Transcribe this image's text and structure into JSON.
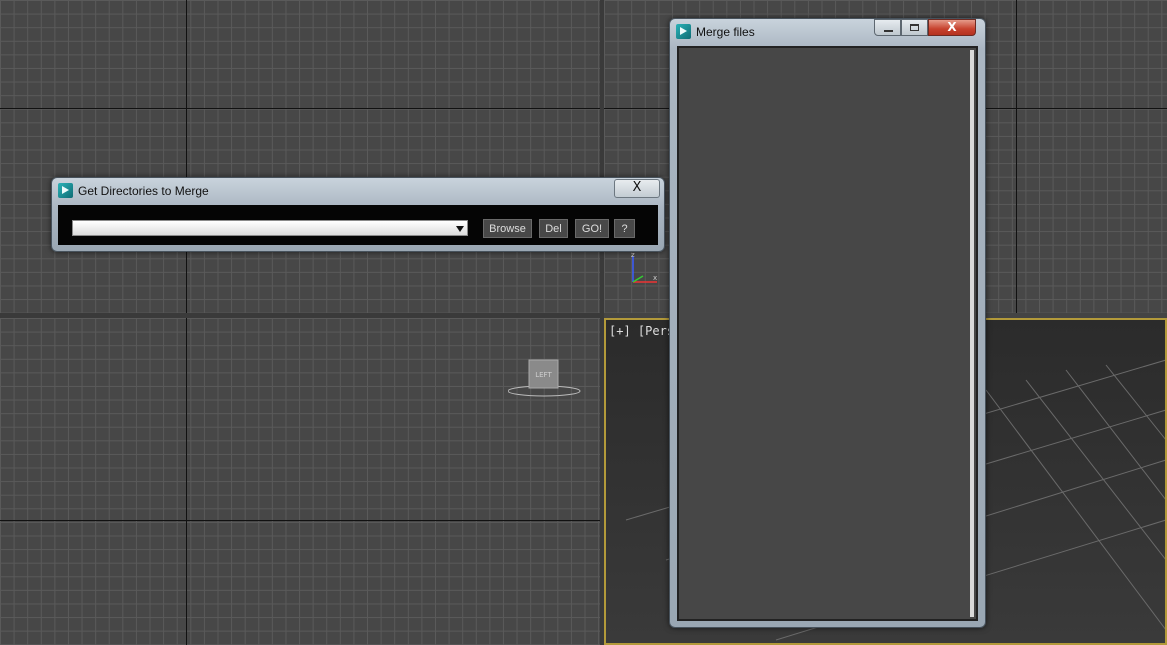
{
  "dir_window": {
    "title": "Get Directories to Merge",
    "close_label": "X",
    "combo_value": "",
    "buttons": {
      "browse": "Browse",
      "del": "Del",
      "go": "GO!",
      "help": "?"
    }
  },
  "merge_window": {
    "title": "Merge files",
    "close_label": "X"
  },
  "viewports": {
    "perspective_label": "[+] [Perspe",
    "viewcube_label": "LEFT",
    "axis_z": "z",
    "axis_x": "x",
    "axis_y": "y"
  },
  "colors": {
    "grid_bg": "#474747",
    "perspective_border": "#b39a3a",
    "close_red": "#c6412d",
    "app_icon": "#1a8f96"
  },
  "icons": [
    "app-icon",
    "dropdown-arrow-icon",
    "minimize-icon",
    "maximize-icon",
    "close-icon"
  ]
}
